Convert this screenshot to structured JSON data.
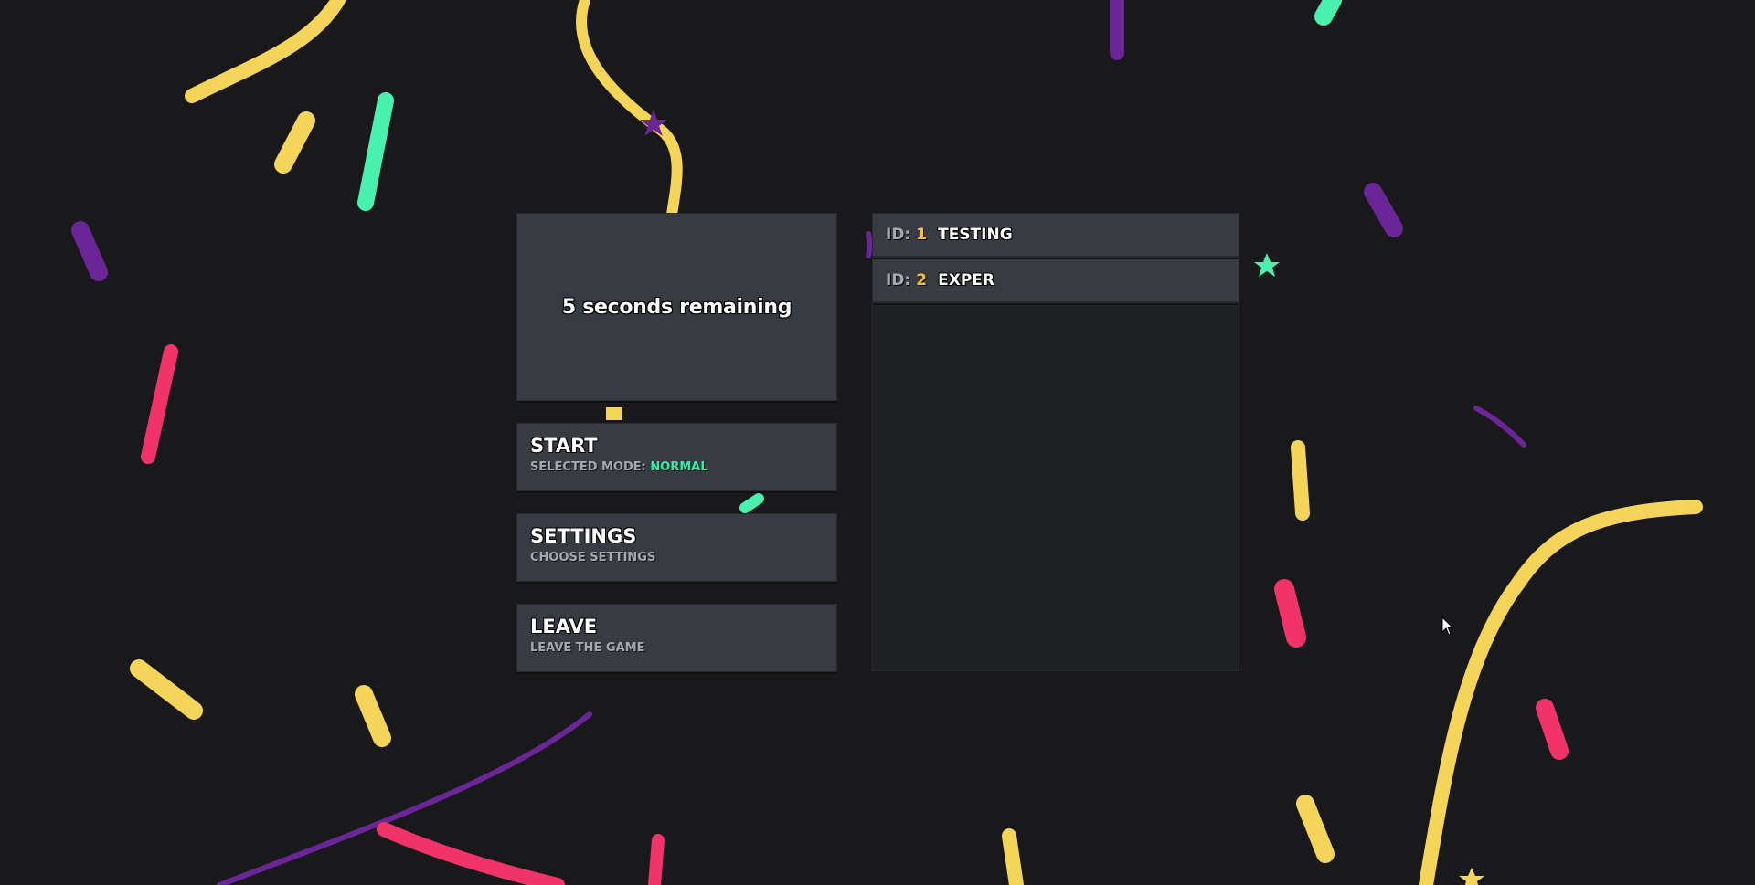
{
  "countdown": {
    "text": "5 seconds remaining"
  },
  "menu": {
    "start": {
      "title": "START",
      "subtitle_prefix": "SELECTED MODE:",
      "mode": "NORMAL"
    },
    "settings": {
      "title": "SETTINGS",
      "subtitle": "CHOOSE SETTINGS"
    },
    "leave": {
      "title": "LEAVE",
      "subtitle": "LEAVE THE GAME"
    }
  },
  "players": [
    {
      "id_label": "ID:",
      "id": "1",
      "name": "TESTING"
    },
    {
      "id_label": "ID:",
      "id": "2",
      "name": "EXPER"
    }
  ],
  "colors": {
    "background": "#19191b",
    "panel": "#393b42",
    "accent_mode": "#2ef0a8",
    "accent_id": "#f7c22e",
    "confetti": [
      "#f5d45a",
      "#6a2696",
      "#f0346a",
      "#49f0ae"
    ]
  },
  "icons": [
    "confetti-decoration",
    "star-icon",
    "mouse-cursor-icon"
  ]
}
